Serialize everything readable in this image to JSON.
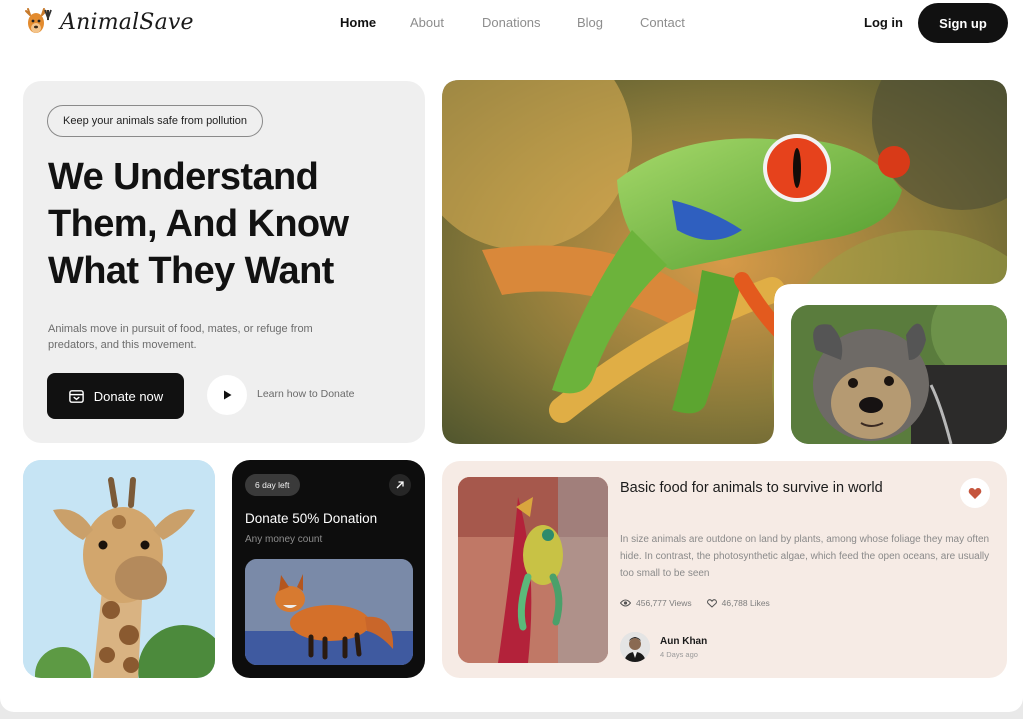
{
  "brand": {
    "name": "AnimalSave"
  },
  "nav": {
    "links": [
      {
        "label": "Home",
        "active": true
      },
      {
        "label": "About",
        "active": false
      },
      {
        "label": "Donations",
        "active": false
      },
      {
        "label": "Blog",
        "active": false
      },
      {
        "label": "Contact",
        "active": false
      }
    ],
    "login_label": "Log in",
    "signup_label": "Sign up"
  },
  "hero": {
    "tagline": "Keep your animals safe from pollution",
    "title": "We Understand Them, And Know What They Want",
    "description": "Animals move in pursuit of food, mates, or refuge from predators, and this movement.",
    "donate_label": "Donate now",
    "learn_label": "Learn how to Donate"
  },
  "donation": {
    "days_left": "6 day left",
    "title": "Donate 50% Donation",
    "subtitle": "Any money count"
  },
  "blog": {
    "title": "Basic food for animals to survive in world",
    "text": "In size animals are outdone on land by plants, among whose foliage they may often hide. In contrast, the photosynthetic algae, which feed the open oceans, are usually too small to be seen",
    "views": "456,777 Views",
    "likes": "46,788 Likes",
    "author": "Aun Khan",
    "posted": "4 Days ago"
  },
  "colors": {
    "primary": "#111111",
    "hero_bg": "#efefef",
    "blog_bg": "#f6ebe5",
    "heart": "#c5553d"
  },
  "icons": [
    "gift-icon",
    "play-icon",
    "arrow-up-right-icon",
    "heart-icon",
    "eye-icon",
    "heart-outline-icon"
  ]
}
